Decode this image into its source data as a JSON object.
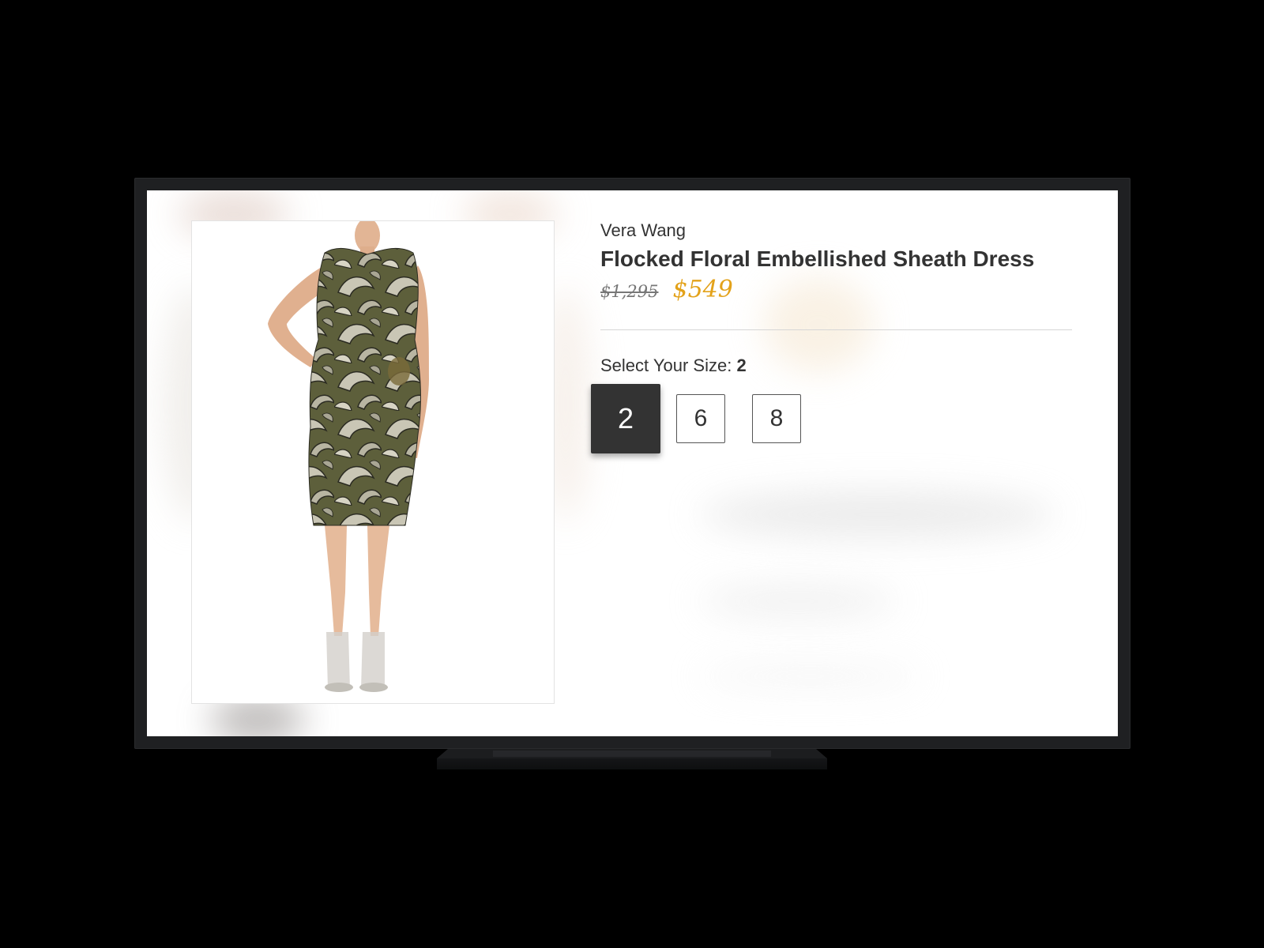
{
  "product": {
    "brand": "Vera Wang",
    "title": "Flocked Floral Embellished Sheath Dress",
    "original_price": "$1,295",
    "sale_price": "$549",
    "image_alt": "dress-photo"
  },
  "size_selector": {
    "label": "Select Your Size:",
    "selected_value": "2",
    "options": [
      "2",
      "6",
      "8"
    ]
  },
  "colors": {
    "sale_price": "#e3a21a",
    "selected_size_bg": "#333333",
    "text": "#333333",
    "bezel": "#1f2022"
  }
}
